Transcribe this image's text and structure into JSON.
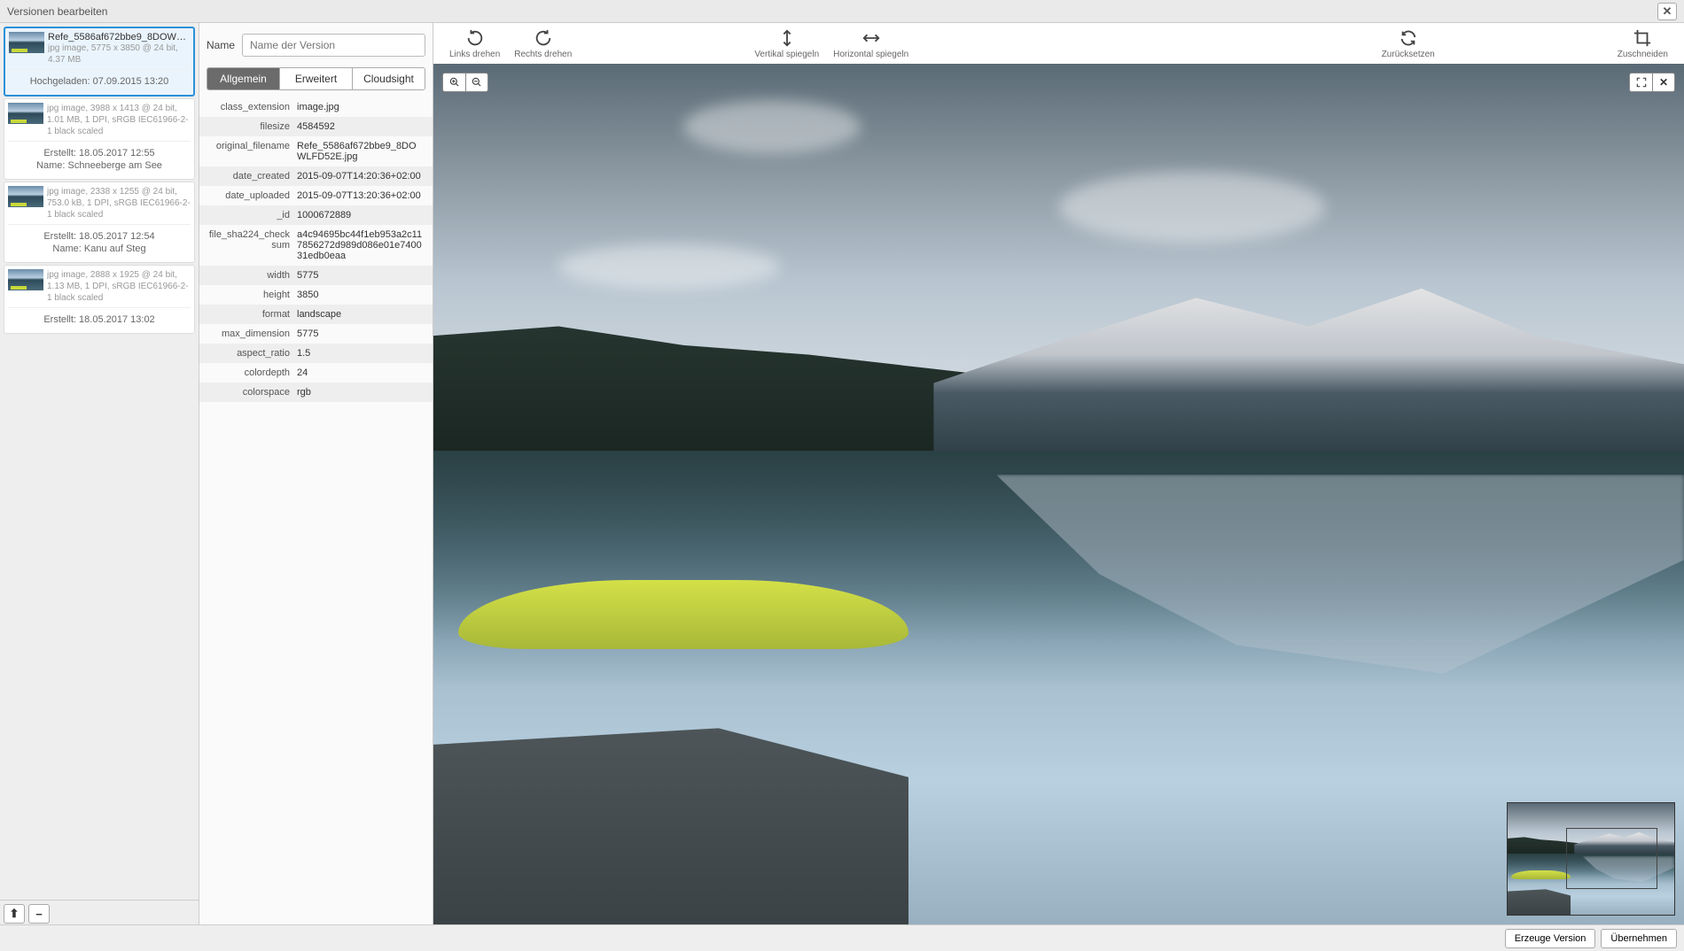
{
  "dialog_title": "Versionen bearbeiten",
  "name_field": {
    "label": "Name",
    "placeholder": "Name der Version",
    "value": ""
  },
  "tabs": {
    "general": "Allgemein",
    "extended": "Erweitert",
    "cloudsight": "Cloudsight"
  },
  "toolbar": {
    "rotate_left": "Links drehen",
    "rotate_right": "Rechts drehen",
    "flip_vertical": "Vertikal spiegeln",
    "flip_horizontal": "Horizontal spiegeln",
    "reset": "Zurücksetzen",
    "crop": "Zuschneiden"
  },
  "footer": {
    "create_version": "Erzeuge Version",
    "apply": "Übernehmen"
  },
  "versions": [
    {
      "title": "Refe_5586af672bbe9_8DOWLFD52E...",
      "meta": "jpg image,  5775 x 3850 @ 24 bit,  4.37 MB",
      "footer_lines": [
        "Hochgeladen: 07.09.2015 13:20"
      ],
      "selected": true
    },
    {
      "title": "",
      "meta": "jpg image,  3988 x 1413 @ 24 bit,  1.01 MB,  1 DPI,  sRGB IEC61966-2-1 black scaled",
      "footer_lines": [
        "Erstellt: 18.05.2017 12:55",
        "Name: Schneeberge am See"
      ],
      "selected": false
    },
    {
      "title": "",
      "meta": "jpg image,  2338 x 1255 @ 24 bit,  753.0 kB,  1 DPI,  sRGB IEC61966-2-1 black scaled",
      "footer_lines": [
        "Erstellt: 18.05.2017 12:54",
        "Name: Kanu auf Steg"
      ],
      "selected": false
    },
    {
      "title": "",
      "meta": "jpg image,  2888 x 1925 @ 24 bit,  1.13 MB,  1 DPI,  sRGB IEC61966-2-1 black scaled",
      "footer_lines": [
        "Erstellt: 18.05.2017 13:02"
      ],
      "selected": false
    }
  ],
  "metadata": [
    {
      "key": "class_extension",
      "val": "image.jpg"
    },
    {
      "key": "filesize",
      "val": "4584592"
    },
    {
      "key": "original_filename",
      "val": "Refe_5586af672bbe9_8DOWLFD52E.jpg"
    },
    {
      "key": "date_created",
      "val": "2015-09-07T14:20:36+02:00"
    },
    {
      "key": "date_uploaded",
      "val": "2015-09-07T13:20:36+02:00"
    },
    {
      "key": "_id",
      "val": "1000672889"
    },
    {
      "key": "file_sha224_checksum",
      "val": "a4c94695bc44f1eb953a2c117856272d989d086e01e740031edb0eaa"
    },
    {
      "key": "width",
      "val": "5775"
    },
    {
      "key": "height",
      "val": "3850"
    },
    {
      "key": "format",
      "val": "landscape"
    },
    {
      "key": "max_dimension",
      "val": "5775"
    },
    {
      "key": "aspect_ratio",
      "val": "1.5"
    },
    {
      "key": "colordepth",
      "val": "24"
    },
    {
      "key": "colorspace",
      "val": "rgb"
    }
  ]
}
